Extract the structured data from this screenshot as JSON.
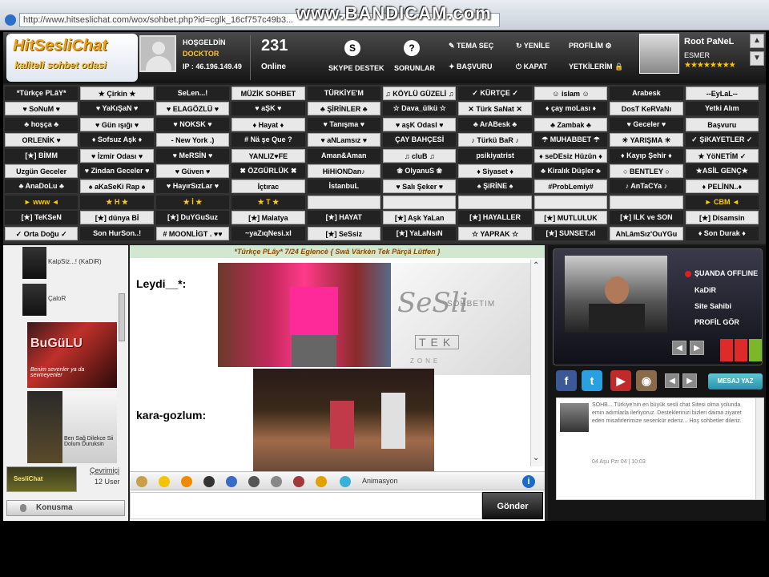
{
  "browser": {
    "url": "http://www.hitseslichat.com/wox/sohbet.php?id=cglk_16cf757c49b3...",
    "watermark": "www.BANDICAM.com"
  },
  "header": {
    "logo_title": "HitSesliChat",
    "logo_sub": "kaliteli sohbet odasi",
    "welcome": "HOŞGELDİN",
    "username": "DOCKTOR",
    "ip": "IP : 46.196.149.49",
    "online_count": "231",
    "online_label": "Online",
    "skype_label": "SKYPE DESTEK",
    "help_label": "SORUNLAR",
    "theme_label": "TEMA SEÇ",
    "refresh_label": "YENİLE",
    "profile_label": "PROFİLİM",
    "apply_label": "BAŞVURU",
    "close_label": "KAPAT",
    "auth_label": "YETKİLERİM",
    "root_name": "Root PaNeL",
    "root_gender": "ESMER",
    "root_stars": "★★★★★★★★"
  },
  "rooms": [
    [
      "*Türkçe PLâY*",
      "★ Çirkin ★",
      "SeLen...!",
      "MÜZİK SOHBET",
      "TÜRKİYE'M",
      "♫ KÖYLÜ GÜZELİ ♫",
      "✓ KÜRTÇE ✓",
      "☺ islam ☺",
      "Arabesk",
      "--EyLaL--"
    ],
    [
      "♥ SoNuM ♥",
      "♥ YaKıŞaN ♥",
      "♥ ELAGÖZLÜ ♥",
      "♥ aŞK ♥",
      "♣ ŞİRİNLER ♣",
      "☆ Dava_ülkü ☆",
      "✕ Türk SaNat ✕",
      "♦ çay moLası ♦",
      "DosT KeRVaNı",
      "Yetki Alım"
    ],
    [
      "♣ hoşça ♣",
      "♥ Gün ışığı ♥",
      "♥ NOKSK ♥",
      "♦ Hayat ♦",
      "♥ Tanışma ♥",
      "♥ aşK OdasI ♥",
      "♣ ArABesk ♣",
      "♣ Zambak ♣",
      "♥ Geceler ♥",
      "Başvuru"
    ],
    [
      "ORLENİK ♥",
      "♦ Sofsuz Aşk ♦",
      "- New York .)",
      "# Nä şe Que ?",
      "♥ aNLamsız ♥",
      "ÇAY BAHÇESİ",
      "♪ Türkü BaR ♪",
      "☂ MUHABBET ☂",
      "☀ YARIŞMA ☀",
      "✓ ŞiKAYETLER ✓"
    ],
    [
      "[★] BİMM",
      "♥ İzmir Odası ♥",
      "♥ MeRSİN ♥",
      "YANLIZ♥FE",
      "Aman&Aman",
      "♫ cluB ♫",
      "psikiyatrist",
      "♦ seDEsiz Hüzün ♦",
      "♦ Kayıp Şehir ♦",
      "★ YöNETİM ✓"
    ],
    [
      "Uzgün Geceler",
      "♥ Zindan Geceler ♥",
      "♥ Güven ♥",
      "✖ ÖZGÜRLÜK ✖",
      "HiHiONDan♪",
      "❀ OlyanuS ❀",
      "♦ Siyaset ♦",
      "♣ Kiralık Düşler ♣",
      "○ BENTLEY ○",
      "★ASİL GENÇ★"
    ],
    [
      "♣ AnaDoLu ♣",
      "♠ aKaSeKi Rap ♠",
      "♥ HayırSızLar ♥",
      "İçtırac",
      "İstanbuL",
      "♥ Salı Şeker ♥",
      "♠ ŞiRİNE ♠",
      "#ProbLemiy#",
      "♪ AnTaCYa ♪",
      "♦ PELİNN..♦"
    ],
    [
      "► www ◄",
      "★ H ★",
      "★ İ ★",
      "★ T ★",
      "",
      "",
      "",
      "",
      "",
      "► CBM ◄"
    ],
    [
      "[★] TeKSeN",
      "[★] dünya Bİ",
      "[★] DuYGuSuz",
      "[★] Malatya",
      "[★] HAYAT",
      "[★] Aşk YaLan",
      "[★] HAYALLER",
      "[★] MUTLULUK",
      "[★] ILK ve SON",
      "[★] Disamsin"
    ],
    [
      "✓ Orta Doğu ✓",
      "Son HurSon..!",
      "# MOONLİGT . ♥♥",
      "~yaZıqNesi.xl",
      "[★] SeSsiz",
      "[★] YaLaNsıN",
      "☆ YAPRAK ☆",
      "[★] SUNSET.xl",
      "AhLâmSız'OuYGu",
      "♦ Son Durak ♦"
    ]
  ],
  "sidebar": {
    "users": [
      {
        "name": "KalpSiz...! (KaDiR)"
      },
      {
        "name": "ÇaloR"
      }
    ],
    "ad1_title": "BuGüLU",
    "ad1_sub": "Benim sevenler ya da sevmeyenler",
    "ad2_sub": "Ben Sağ Dilekce Sii Dolum Duruksin",
    "chat_app": "SesliChat",
    "online_users_label": "Çevrimiçi",
    "user_count": "12 User",
    "talk_label": "Konusma"
  },
  "chat": {
    "banner": "*Türkçe PLây* 7/24 Eglencè { Swä Värkèn Tek Pärçä Lütfen }",
    "messages": [
      {
        "author": "Leydi__*:"
      },
      {
        "author": "kara-gozlum:"
      }
    ],
    "logo_big": "SeSli",
    "logo_sohbetim": "SOHBETIM",
    "logo_tek": "TEK",
    "logo_bottom": "ZONE",
    "anim_label": "Animasyon",
    "send_label": "Gönder",
    "input_value": ""
  },
  "right": {
    "status": "ŞUANDA OFFLINE",
    "owner_name": "KaDiR",
    "owner_role": "Site Sahibi",
    "profile_link": "PROFİL GÖR",
    "message_button": "MESAJ YAZ",
    "news_text": "SOHB... Türkiye'nin en büyük sesli chat Sitesi olma yolunda emin adımlarla ilerliyoruz. Desteklerinizi bizleri daima ziyaret eden misafirlerimize sesenkür ederiz... Hoş sohbetler dileriz.",
    "news_date": "04 Aşu Pzr 04 | 10:03"
  },
  "colors": {
    "gold": "#ffcc00",
    "accent": "#e8a21a"
  }
}
